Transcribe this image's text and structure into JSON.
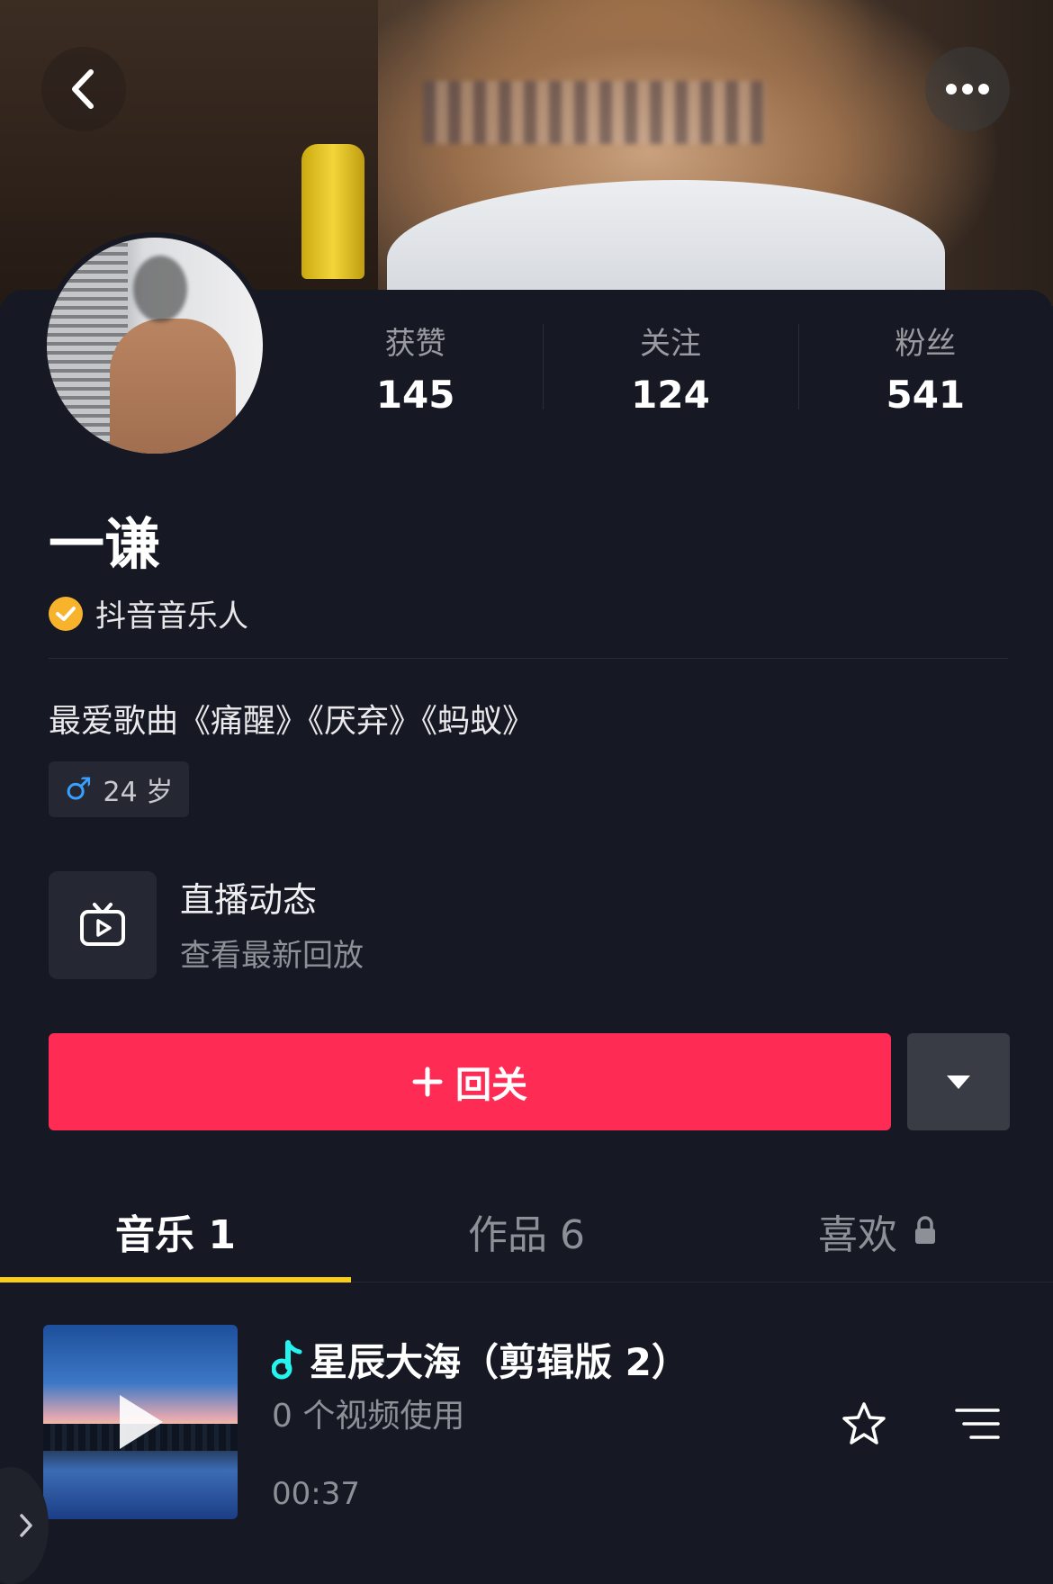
{
  "header": {
    "back_icon": "chevron-left-icon",
    "more_icon": "more-dots-icon"
  },
  "stats": [
    {
      "label": "获赞",
      "value": "145"
    },
    {
      "label": "关注",
      "value": "124"
    },
    {
      "label": "粉丝",
      "value": "541"
    }
  ],
  "profile": {
    "name": "一谦",
    "verified_label": "抖音音乐人",
    "verified_color": "#f7b32b",
    "bio": "最爱歌曲《痛醒》《厌弃》《蚂蚁》",
    "gender_symbol": "♂",
    "age_tag": "24 岁"
  },
  "live": {
    "title": "直播动态",
    "subtitle": "查看最新回放",
    "icon": "tv-play-icon"
  },
  "actions": {
    "follow_back_label": "回关",
    "follow_color": "#fe2c55",
    "dropdown_icon": "caret-down-icon"
  },
  "tabs": [
    {
      "label": "音乐 1",
      "active": true
    },
    {
      "label": "作品 6",
      "active": false
    },
    {
      "label": "喜欢",
      "active": false,
      "locked": true
    }
  ],
  "tab_indicator_color": "#face15",
  "songs": [
    {
      "title": "星辰大海（剪辑版 2）",
      "usage": "0 个视频使用",
      "duration": "00:37"
    }
  ]
}
